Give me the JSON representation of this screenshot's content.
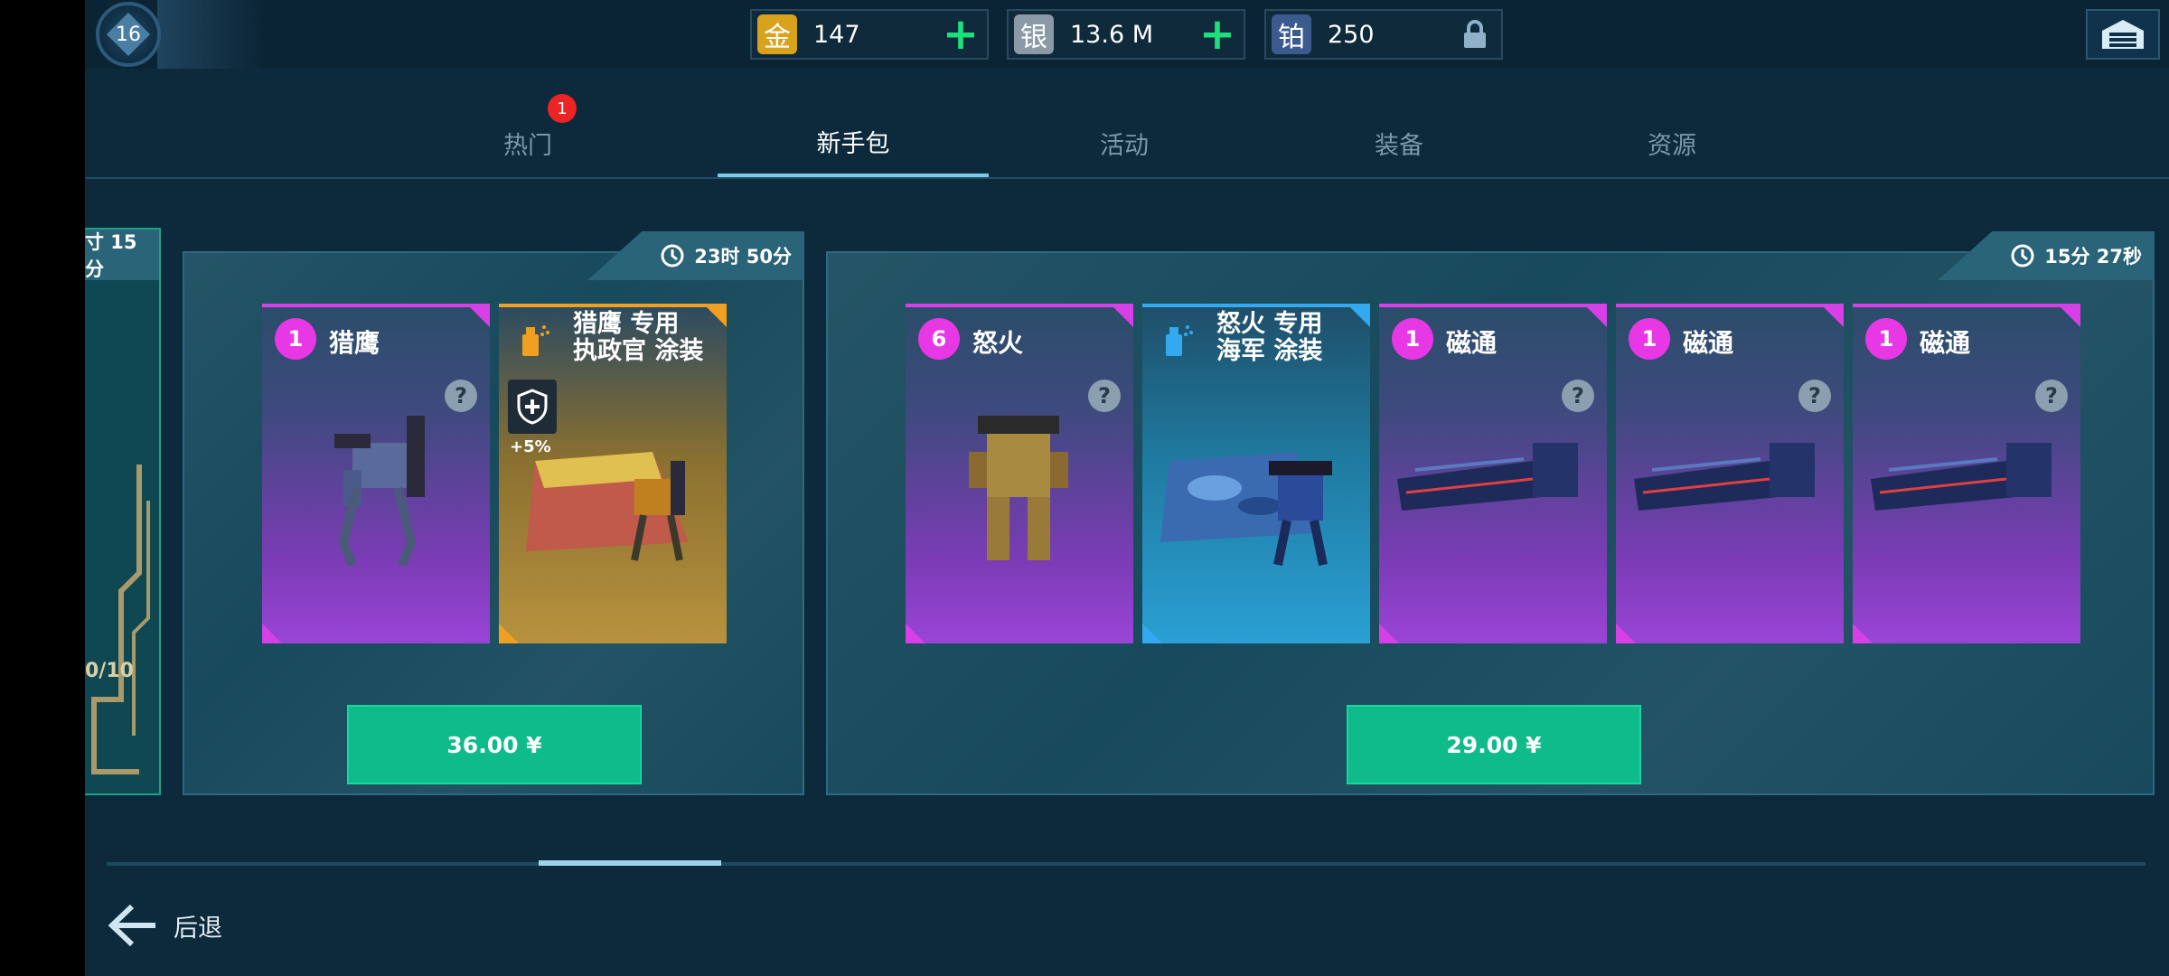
{
  "header": {
    "level": "16",
    "currencies": [
      {
        "label": "金",
        "value": "147",
        "color": "#d8a21c",
        "action": "plus"
      },
      {
        "label": "银",
        "value": "13.6 M",
        "color": "#8a9aa6",
        "action": "plus"
      },
      {
        "label": "铂",
        "value": "250",
        "color": "#3b5b8f",
        "action": "lock"
      }
    ]
  },
  "tabs": [
    {
      "label": "热门",
      "badge": "1"
    },
    {
      "label": "新手包",
      "active": true
    },
    {
      "label": "活动"
    },
    {
      "label": "装备"
    },
    {
      "label": "资源"
    }
  ],
  "left_peek": {
    "timer": "寸 15分",
    "progress": "0/10"
  },
  "offers": [
    {
      "timer": "23时 50分",
      "price": "36.00 ¥",
      "items": [
        {
          "qty": "1",
          "name": "猎鹰",
          "rarity": "purple",
          "icon": "robot-falcon"
        },
        {
          "name_line1": "猎鹰 专用",
          "name_line2": "执政官 涂装",
          "rarity": "gold",
          "bonus": "+5%",
          "icon": "spray-paint-icon"
        }
      ]
    },
    {
      "timer": "15分 27秒",
      "price": "29.00 ¥",
      "items": [
        {
          "qty": "6",
          "name": "怒火",
          "rarity": "purple",
          "icon": "robot-fury"
        },
        {
          "name_line1": "怒火 专用",
          "name_line2": "海军 涂装",
          "rarity": "blue",
          "icon": "spray-paint-icon"
        },
        {
          "qty": "1",
          "name": "磁通",
          "rarity": "purple",
          "icon": "weapon-flux"
        },
        {
          "qty": "1",
          "name": "磁通",
          "rarity": "purple",
          "icon": "weapon-flux"
        },
        {
          "qty": "1",
          "name": "磁通",
          "rarity": "purple",
          "icon": "weapon-flux"
        }
      ]
    }
  ],
  "footer": {
    "back_label": "后退"
  }
}
